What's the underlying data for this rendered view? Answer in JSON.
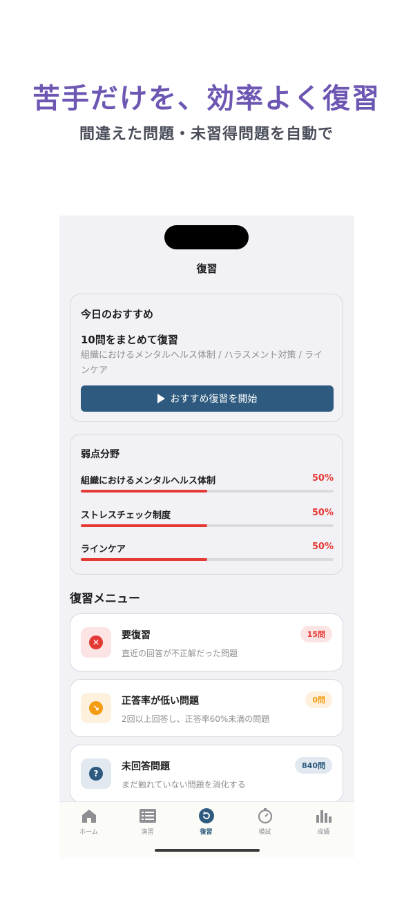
{
  "promo": {
    "headline": "苦手だけを、効率よく復習",
    "subheadline": "間違えた問題・未習得問題を自動で"
  },
  "nav": {
    "title": "復習"
  },
  "recommendation": {
    "title": "今日のおすすめ",
    "heading": "10問をまとめて復習",
    "topics": "組織におけるメンタルヘルス体制 / ハラスメント対策 / ラインケア",
    "start_label": "おすすめ復習を開始"
  },
  "weak_areas": {
    "title": "弱点分野",
    "items": [
      {
        "name": "組織におけるメンタルヘルス体制",
        "percent": "50%",
        "fill": 0.5
      },
      {
        "name": "ストレスチェック制度",
        "percent": "50%",
        "fill": 0.5
      },
      {
        "name": "ラインケア",
        "percent": "50%",
        "fill": 0.5
      }
    ]
  },
  "review_menu": {
    "title": "復習メニュー",
    "items": [
      {
        "label": "要復習",
        "description": "直近の回答が不正解だった問題",
        "badge": "15問",
        "icon": "x-circle-icon",
        "icon_glyph": "✕",
        "accent": "#e53935",
        "icon_bg": "#fde4e4",
        "badge_bg": "#fde4e4",
        "badge_color": "#e53935"
      },
      {
        "label": "正答率が低い問題",
        "description": "2回以上回答し、正答率60%未満の問題",
        "badge": "0問",
        "icon": "trend-down-icon",
        "icon_glyph": "↘",
        "accent": "#f39c12",
        "icon_bg": "#fdf0dc",
        "badge_bg": "#fdf0dc",
        "badge_color": "#f39c12"
      },
      {
        "label": "未回答問題",
        "description": "まだ触れていない問題を消化する",
        "badge": "840問",
        "icon": "question-icon",
        "icon_glyph": "?",
        "accent": "#2d5a7e",
        "icon_bg": "#e1e8ef",
        "badge_bg": "#e1e8ef",
        "badge_color": "#2d5a7e"
      }
    ]
  },
  "tabbar": {
    "tabs": [
      {
        "label": "ホーム",
        "icon": "home-icon"
      },
      {
        "label": "演習",
        "icon": "list-icon"
      },
      {
        "label": "復習",
        "icon": "review-icon",
        "active": true
      },
      {
        "label": "模試",
        "icon": "stopwatch-icon"
      },
      {
        "label": "成績",
        "icon": "bar-chart-icon"
      }
    ]
  },
  "colors": {
    "brand": "#2d5a7e",
    "headline": "#6d57b3",
    "danger": "#e53935"
  }
}
